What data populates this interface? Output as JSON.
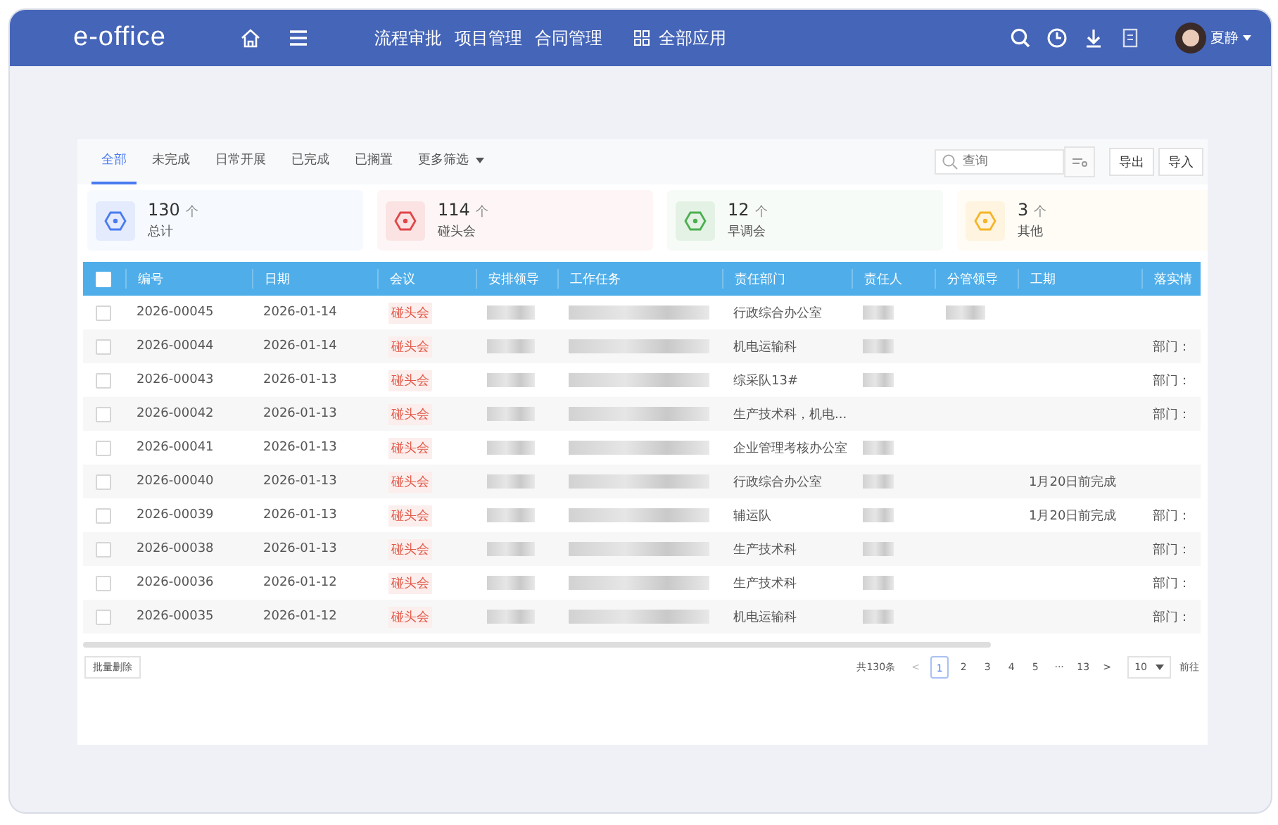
{
  "header": {
    "logo": "e-office",
    "nav": [
      "流程审批",
      "项目管理",
      "合同管理"
    ],
    "all_apps": "全部应用",
    "user": "夏静"
  },
  "tabs": [
    {
      "label": "全部",
      "selected": true
    },
    {
      "label": "未完成",
      "selected": false
    },
    {
      "label": "日常开展",
      "selected": false
    },
    {
      "label": "已完成",
      "selected": false
    },
    {
      "label": "已搁置",
      "selected": false
    }
  ],
  "more_filter": "更多筛选",
  "search": {
    "placeholder": "查询"
  },
  "buttons": [
    "导出",
    "导入"
  ],
  "stats": [
    {
      "count": "130",
      "unit": "个",
      "label": "总计",
      "color": "#4a7cf0"
    },
    {
      "count": "114",
      "unit": "个",
      "label": "碰头会",
      "color": "#e0474a"
    },
    {
      "count": "12",
      "unit": "个",
      "label": "早调会",
      "color": "#4caf50"
    },
    {
      "count": "3",
      "unit": "个",
      "label": "其他",
      "color": "#f5b52a"
    }
  ],
  "table": {
    "select_all": {
      "checked": false
    },
    "columns": [
      "编号",
      "日期",
      "会议",
      "安排领导",
      "工作任务",
      "责任部门",
      "责任人",
      "分管领导",
      "工期",
      "落实情"
    ],
    "rows": [
      {
        "checked": false,
        "number": "2026-00045",
        "date": "2026-01-14",
        "meeting": "碰头会",
        "dept": "行政综合办公室",
        "leader_blurred": true,
        "task_blurred": true,
        "person_blurred": true,
        "supervisor_blurred": true
      },
      {
        "checked": false,
        "number": "2026-00044",
        "date": "2026-01-14",
        "meeting": "碰头会",
        "dept": "机电运输科",
        "leader_blurred": true,
        "task_blurred": true,
        "person_blurred": true,
        "supervisor_blurred": false,
        "status": "部门："
      },
      {
        "checked": false,
        "number": "2026-00043",
        "date": "2026-01-13",
        "meeting": "碰头会",
        "dept": "综采队13#",
        "leader_blurred": true,
        "task_blurred": true,
        "person_blurred": true,
        "supervisor_blurred": false,
        "status": "部门："
      },
      {
        "checked": false,
        "number": "2026-00042",
        "date": "2026-01-13",
        "meeting": "碰头会",
        "dept": "生产技术科，机电...",
        "leader_blurred": true,
        "task_blurred": true,
        "person_blurred": false,
        "supervisor_blurred": false,
        "status": "部门："
      },
      {
        "checked": false,
        "number": "2026-00041",
        "date": "2026-01-13",
        "meeting": "碰头会",
        "dept": "企业管理考核办公室",
        "leader_blurred": true,
        "task_blurred": true,
        "person_blurred": true,
        "supervisor_blurred": false
      },
      {
        "checked": false,
        "number": "2026-00040",
        "date": "2026-01-13",
        "meeting": "碰头会",
        "dept": "行政综合办公室",
        "leader_blurred": true,
        "task_blurred": true,
        "person_blurred": true,
        "supervisor_blurred": false,
        "period": "1月20日前完成"
      },
      {
        "checked": false,
        "number": "2026-00039",
        "date": "2026-01-13",
        "meeting": "碰头会",
        "dept": "辅运队",
        "leader_blurred": true,
        "task_blurred": true,
        "person_blurred": true,
        "supervisor_blurred": false,
        "period": "1月20日前完成",
        "status": "部门："
      },
      {
        "checked": false,
        "number": "2026-00038",
        "date": "2026-01-13",
        "meeting": "碰头会",
        "dept": "生产技术科",
        "leader_blurred": true,
        "task_blurred": true,
        "person_blurred": true,
        "supervisor_blurred": false,
        "status": "部门："
      },
      {
        "checked": false,
        "number": "2026-00036",
        "date": "2026-01-12",
        "meeting": "碰头会",
        "dept": "生产技术科",
        "leader_blurred": true,
        "task_blurred": true,
        "person_blurred": true,
        "supervisor_blurred": false,
        "status": "部门："
      },
      {
        "checked": false,
        "number": "2026-00035",
        "date": "2026-01-12",
        "meeting": "碰头会",
        "dept": "机电运输科",
        "leader_blurred": true,
        "task_blurred": true,
        "person_blurred": true,
        "supervisor_blurred": false,
        "status": "部门："
      }
    ]
  },
  "footer": {
    "batch_delete": "批量删除",
    "total": "共130条",
    "prev": "<",
    "pages": [
      {
        "label": "1",
        "selected": true
      },
      {
        "label": "2",
        "selected": false
      },
      {
        "label": "3",
        "selected": false
      },
      {
        "label": "4",
        "selected": false
      },
      {
        "label": "5",
        "selected": false
      },
      {
        "label": "···",
        "selected": false
      },
      {
        "label": "13",
        "selected": false
      }
    ],
    "next": ">",
    "page_size": "10",
    "goto": "前往"
  }
}
